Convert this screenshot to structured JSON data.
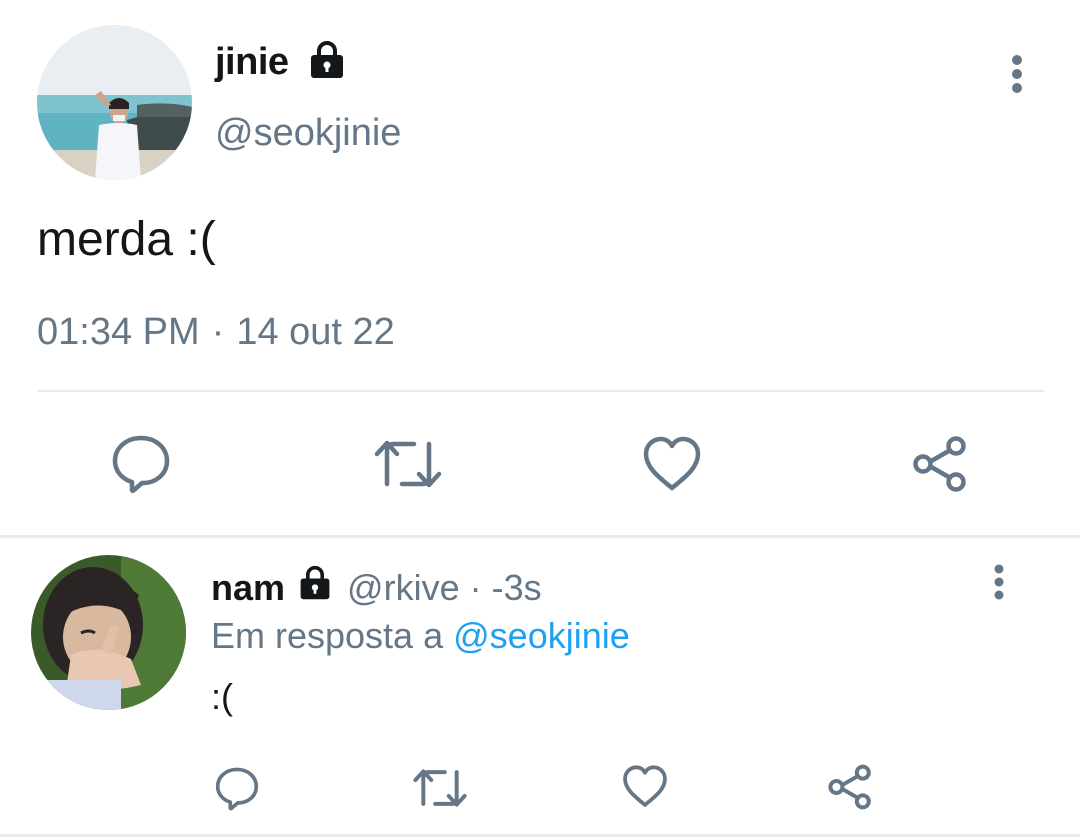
{
  "main_tweet": {
    "display_name": "jinie",
    "handle": "@seokjinie",
    "text": "merda :(",
    "time": "01:34 PM",
    "separator": "·",
    "date": "14 out 22",
    "avatar_icon": "avatar-photo",
    "lock_icon": "lock-icon",
    "more_icon": "more-vertical-icon",
    "actions": {
      "reply_icon": "reply-icon",
      "retweet_icon": "retweet-icon",
      "like_icon": "heart-icon",
      "share_icon": "share-icon"
    }
  },
  "reply_tweet": {
    "display_name": "nam",
    "handle": "@rkive",
    "dot": "·",
    "time": "-3s",
    "in_reply_to_prefix": "Em resposta a",
    "in_reply_to_mention": "@seokjinie",
    "text": ":(",
    "avatar_icon": "avatar-photo",
    "lock_icon": "lock-icon",
    "more_icon": "more-vertical-icon"
  },
  "colors": {
    "primary_text": "#14171a",
    "secondary_text": "#657786",
    "mention_blue": "#1da1f2",
    "divider": "#e6ecf0"
  }
}
